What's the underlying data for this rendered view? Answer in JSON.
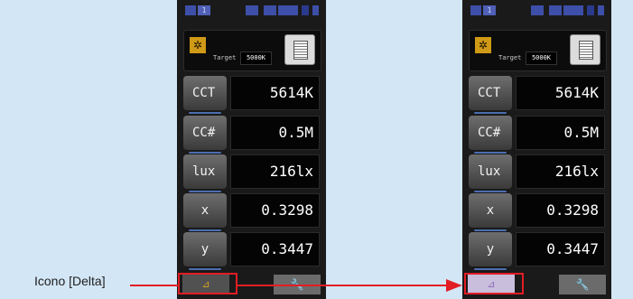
{
  "status": {
    "channel": "1"
  },
  "target": {
    "label": "Target",
    "value": "5000K"
  },
  "rows": [
    {
      "label": "CCT",
      "value": "5614K"
    },
    {
      "label": "CC#",
      "value": "0.5M"
    },
    {
      "label": "lux",
      "value": "216lx"
    },
    {
      "label": "x",
      "value": "0.3298"
    },
    {
      "label": "y",
      "value": "0.3447"
    }
  ],
  "icons": {
    "sun": "✲",
    "delta": "⊿",
    "wrench": "🔧"
  },
  "caption": "Icono [Delta]",
  "colors": {
    "highlight": "#e21d24",
    "delta_selected": "#c9bedc"
  }
}
